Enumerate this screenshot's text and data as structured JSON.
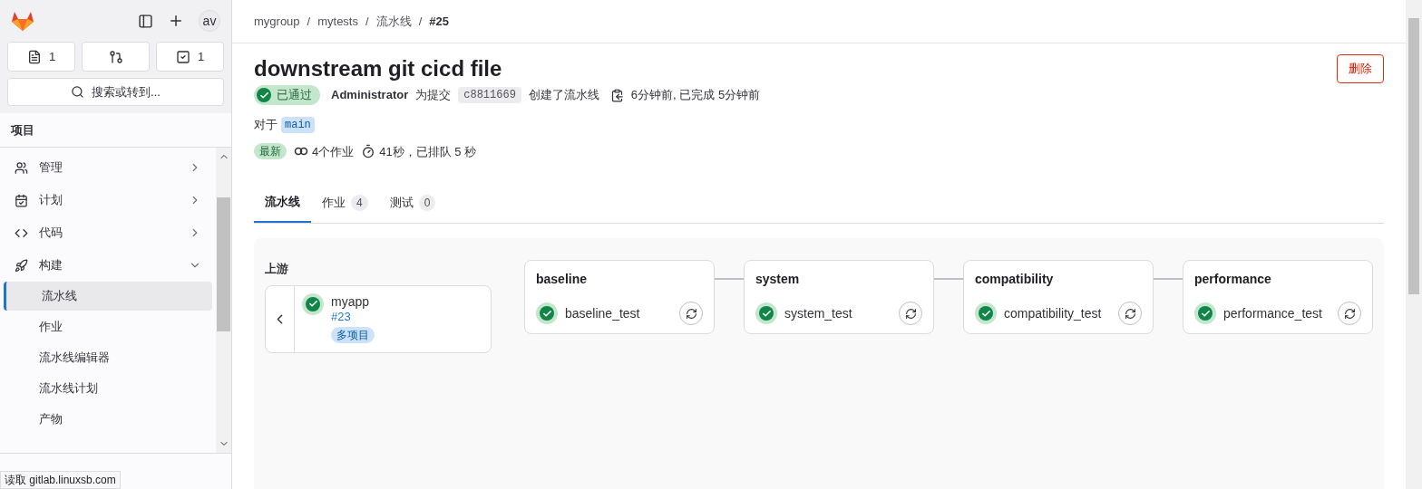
{
  "sidebar": {
    "avatar": "av",
    "counters": [
      {
        "kind": "issues",
        "count": "1"
      },
      {
        "kind": "merge_requests"
      },
      {
        "kind": "todos",
        "count": "1"
      }
    ],
    "search": {
      "placeholder": "搜索或转到..."
    },
    "section_title": "项目",
    "items": [
      {
        "kind": "manage",
        "label": "管理",
        "expanded": false
      },
      {
        "kind": "plan",
        "label": "计划",
        "expanded": false
      },
      {
        "kind": "code",
        "label": "代码",
        "expanded": false
      },
      {
        "kind": "build",
        "label": "构建",
        "expanded": true,
        "children": [
          {
            "label": "流水线",
            "selected": true
          },
          {
            "label": "作业",
            "selected": false
          },
          {
            "label": "流水线编辑器",
            "selected": false
          },
          {
            "label": "流水线计划",
            "selected": false
          },
          {
            "label": "产物",
            "selected": false
          }
        ]
      }
    ],
    "footer": {
      "kind": "partly_covered"
    }
  },
  "status_bar": "读取 gitlab.linuxsb.com",
  "breadcrumbs": [
    {
      "label": "mygroup"
    },
    {
      "separator": "/",
      "label": "mytests"
    },
    {
      "separator": "/",
      "label": "流水线"
    },
    {
      "separator": "/",
      "label": "#25"
    }
  ],
  "title": "downstream git cicd file",
  "delete_button": "删除",
  "status": {
    "label": "已通过",
    "passed": true
  },
  "author": "Administrator",
  "commit_prefix": "为提交",
  "commit": "c8811669",
  "commit_suffix": "创建了流水线",
  "times": "6分钟前, 已完成 5分钟前",
  "ref_prefix": "对于",
  "ref": "main",
  "latest_badge": "最新",
  "jobs": "4个作业",
  "duration": "41秒，已排队 5 秒",
  "tabs": [
    {
      "label": "流水线",
      "selected": true
    },
    {
      "label": "作业",
      "count": "4",
      "selected": false
    },
    {
      "label": "测试",
      "count": "0",
      "selected": false
    }
  ],
  "upstream": {
    "title": "上游",
    "name": "myapp",
    "id": "#23",
    "tag": "多项目",
    "passed": true
  },
  "stages": [
    {
      "name": "baseline",
      "jobs": [
        {
          "name": "baseline_test",
          "passed": true
        }
      ]
    },
    {
      "name": "system",
      "jobs": [
        {
          "name": "system_test",
          "passed": true
        }
      ]
    },
    {
      "name": "compatibility",
      "jobs": [
        {
          "name": "compatibility_test",
          "passed": true
        }
      ]
    },
    {
      "name": "performance",
      "jobs": [
        {
          "name": "performance_test",
          "passed": true
        }
      ]
    }
  ]
}
